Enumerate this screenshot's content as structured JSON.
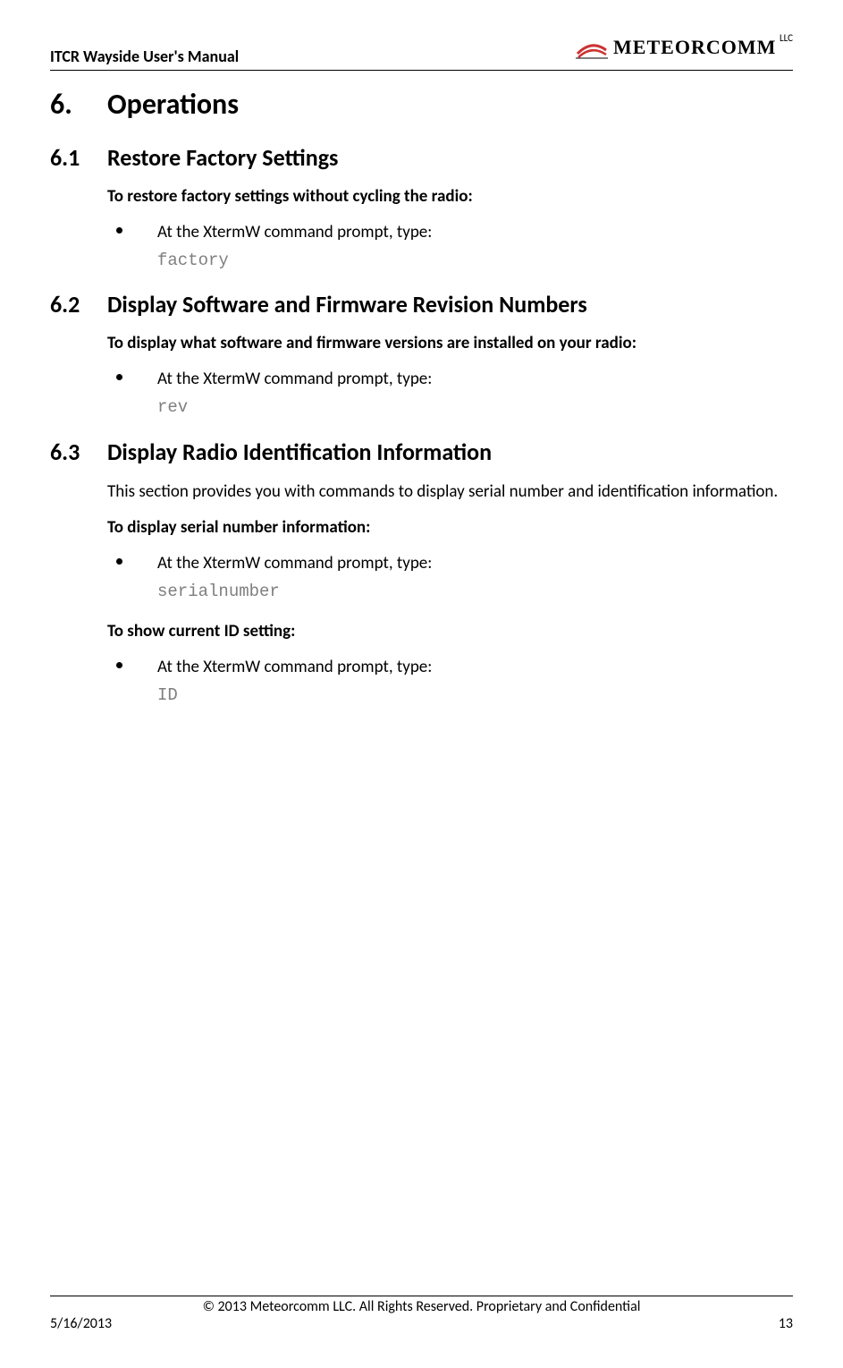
{
  "header": {
    "doc_title": "ITCR Wayside User's Manual",
    "company": "METEORCOMM",
    "company_suffix": "LLC"
  },
  "h1": {
    "num": "6.",
    "title": "Operations"
  },
  "s61": {
    "num": "6.1",
    "title": "Restore Factory Settings",
    "lead": "To restore factory settings without cycling the radio:",
    "step": "At the XtermW command prompt, type:",
    "cmd": "factory"
  },
  "s62": {
    "num": "6.2",
    "title": "Display Software and Firmware Revision Numbers",
    "lead": "To display what software and firmware versions are installed on your radio:",
    "step": "At the XtermW command prompt, type:",
    "cmd": "rev"
  },
  "s63": {
    "num": "6.3",
    "title": "Display Radio Identification Information",
    "intro": "This section provides you with commands to display serial number and identification information.",
    "lead1": "To display serial number information:",
    "step1": "At the XtermW command prompt, type:",
    "cmd1": "serialnumber",
    "lead2": "To show current ID setting:",
    "step2": "At the XtermW command prompt, type:",
    "cmd2": "ID"
  },
  "footer": {
    "copyright": "© 2013 Meteorcomm LLC. All Rights Reserved. Proprietary and Confidential",
    "date": "5/16/2013",
    "page": "13"
  }
}
